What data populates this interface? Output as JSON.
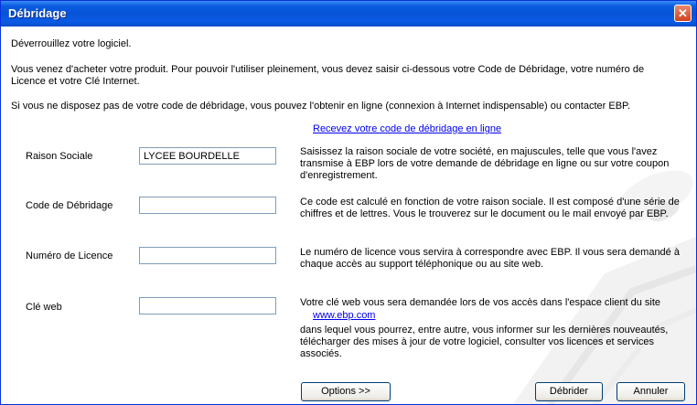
{
  "window": {
    "title": "Débridage",
    "close_label": "✕"
  },
  "intro": {
    "line1": "Déverrouillez votre logiciel.",
    "line2a": "Vous venez d'acheter votre produit. Pour pouvoir l'utiliser pleinement, vous devez saisir ci-dessous votre Code de Débridage, votre numéro de",
    "line2b": "Licence et votre Clé Internet.",
    "line3": "Si vous ne disposez pas de votre code de débridage, vous pouvez l'obtenir en ligne (connexion à Internet indispensable) ou contacter EBP."
  },
  "online_link": "Recevez votre code de débridage en ligne",
  "fields": {
    "raison": {
      "label": "Raison Sociale",
      "value": "LYCEE BOURDELLE",
      "help": [
        "Saisissez la raison sociale de votre société, en majuscules, telle que vous l'avez",
        "transmise à EBP lors de votre demande de débridage en ligne ou sur votre coupon",
        "d'enregistrement."
      ]
    },
    "code": {
      "label": "Code de Débridage",
      "value": "",
      "help": [
        "Ce code est calculé en fonction de votre raison sociale. Il est composé d'une série de",
        "chiffres et de lettres. Vous le trouverez sur le document ou le mail envoyé par EBP."
      ]
    },
    "licence": {
      "label": "Numéro de Licence",
      "value": "",
      "help": [
        "Le numéro de licence vous servira à correspondre avec EBP. Il vous sera demandé à",
        "chaque accès au support téléphonique ou au site web."
      ]
    },
    "cle": {
      "label": "Clé web",
      "value": "",
      "help1": "Votre clé web vous sera demandée lors de vos accès dans l'espace client du site",
      "link": "www.ebp.com",
      "help2": [
        "dans lequel vous pourrez, entre autre, vous informer sur les dernières nouveautés,",
        "télécharger des mises à jour de votre logiciel, consulter vos licences et services",
        "associés."
      ]
    }
  },
  "buttons": {
    "options": "Options  >>",
    "debrider": "Débrider",
    "annuler": "Annuler"
  }
}
